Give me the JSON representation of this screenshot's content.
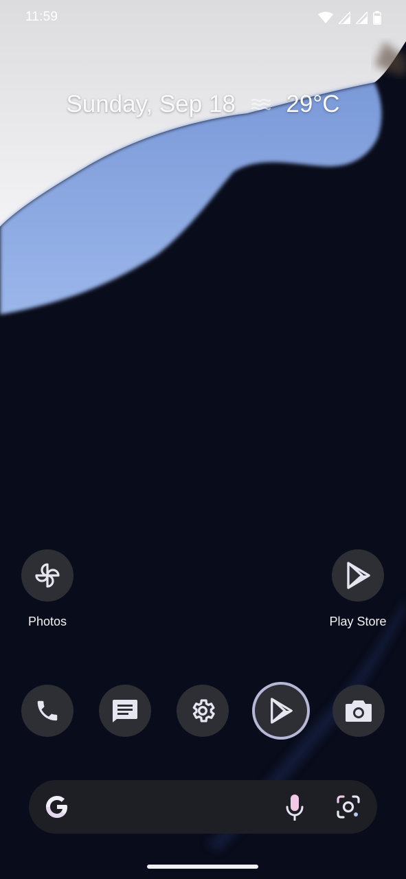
{
  "status_bar": {
    "time": "11:59",
    "icons": [
      "wifi-icon",
      "signal-icon",
      "signal-icon",
      "battery-icon"
    ]
  },
  "glance": {
    "date": "Sunday, Sep 18",
    "weather_icon": "haze-icon",
    "temperature": "29°C"
  },
  "home_apps": [
    {
      "label": "Photos",
      "icon": "photos-pinwheel-icon"
    },
    {
      "label": "Play Store",
      "icon": "play-store-icon"
    }
  ],
  "dock": [
    {
      "icon": "phone-icon"
    },
    {
      "icon": "messages-icon"
    },
    {
      "icon": "settings-gear-icon"
    },
    {
      "icon": "play-store-icon",
      "focused": true
    },
    {
      "icon": "camera-icon"
    }
  ],
  "search_bar": {
    "logo": "google-g-icon",
    "mic": "microphone-icon",
    "lens": "lens-icon"
  },
  "colors": {
    "background": "#090c1a",
    "icon_bg": "#2e2f35",
    "focus_ring": "#b6b8d6",
    "wallpaper_blue": "#7e9fdc"
  }
}
